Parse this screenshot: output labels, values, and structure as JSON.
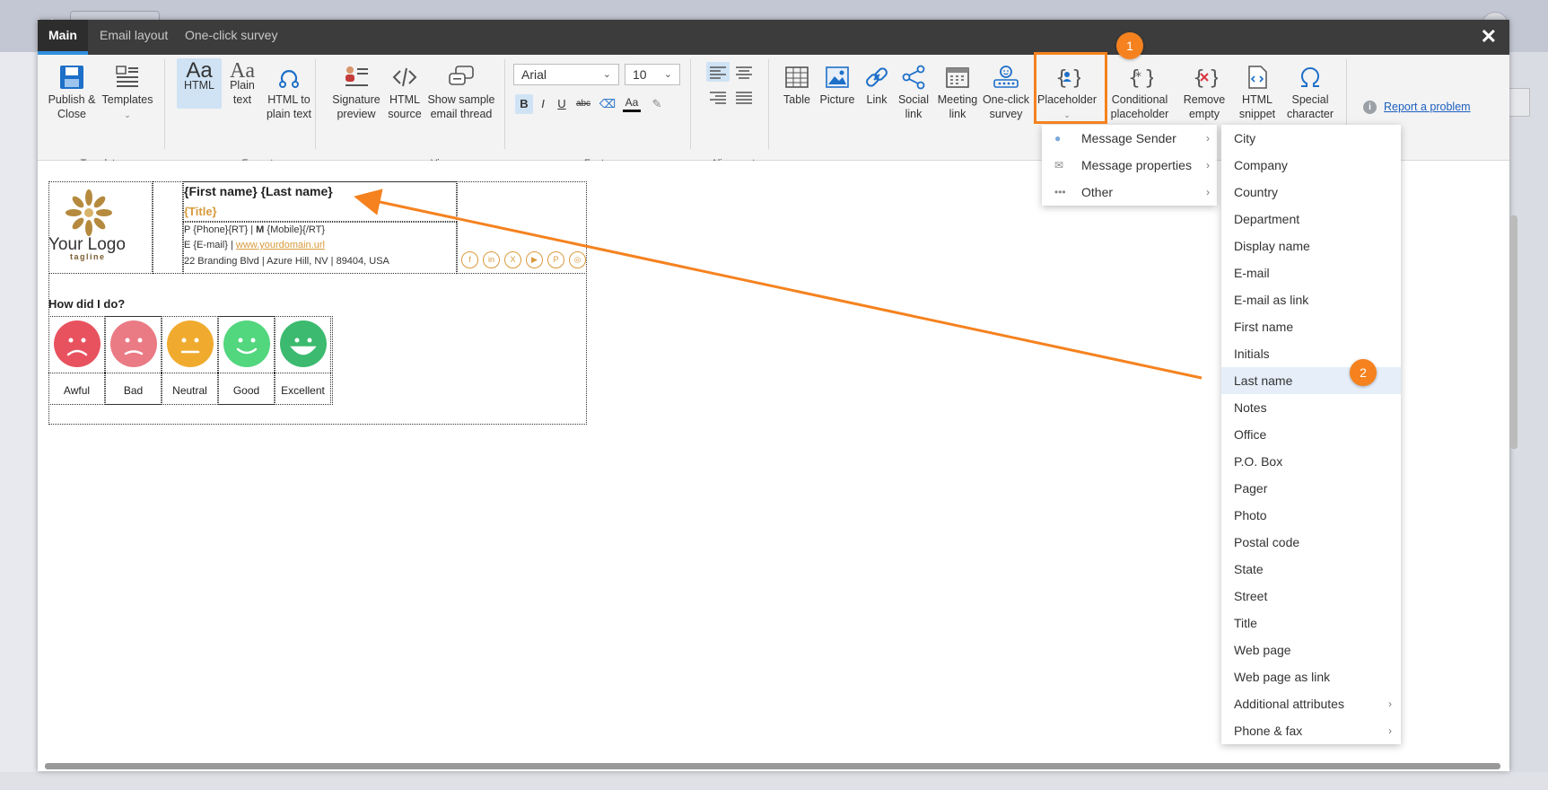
{
  "tabs": [
    {
      "label": "Main"
    },
    {
      "label": "Email layout"
    },
    {
      "label": "One-click survey"
    }
  ],
  "ribbon": {
    "template": {
      "publish": "Publish &\nClose",
      "templates": "Templates",
      "group": "Template"
    },
    "format": {
      "html": "HTML",
      "plain": "Plain\ntext",
      "html_to_plain": "HTML to\nplain text",
      "group": "Format"
    },
    "view": {
      "signature_preview": "Signature\npreview",
      "html_source": "HTML\nsource",
      "sample_thread": "Show sample\nemail thread",
      "group": "View"
    },
    "font": {
      "family": "Arial",
      "size": "10",
      "group": "Font",
      "bold": "B",
      "italic": "I",
      "underline": "U",
      "strike": "abc",
      "font_color": "Aa"
    },
    "alignment": {
      "group": "Alignment"
    },
    "insert": {
      "table": "Table",
      "picture": "Picture",
      "link": "Link",
      "social_link": "Social\nlink",
      "meeting_link": "Meeting\nlink",
      "one_click_survey": "One-click\nsurvey",
      "placeholder": "Placeholder",
      "conditional_placeholder": "Conditional\nplaceholder",
      "remove_empty": "Remove\nempty",
      "html_snippet": "HTML\nsnippet",
      "special_character": "Special\ncharacter"
    },
    "report_problem": "Report a problem"
  },
  "callouts": {
    "one": "1",
    "two": "2"
  },
  "signature": {
    "logo_text": "Your Logo",
    "tagline": "tagline",
    "name": "{First name} {Last name}",
    "title": "{Title}",
    "phone_label_p": "P",
    "phone_value": "{Phone}{RT}",
    "mobile_label_m": "M",
    "mobile_value": "{Mobile}{/RT}",
    "email_label": "E",
    "email_value": "{E-mail}",
    "website": "www.yourdomain.url",
    "address": "22 Branding Blvd | Azure Hill, NV | 89404, USA",
    "socials": [
      "f",
      "in",
      "X",
      "▶",
      "P",
      "◎"
    ]
  },
  "survey": {
    "question": "How did I do?",
    "options": [
      {
        "label": "Awful",
        "color": "#e8525f"
      },
      {
        "label": "Bad",
        "color": "#ea7a84"
      },
      {
        "label": "Neutral",
        "color": "#f0ab2e"
      },
      {
        "label": "Good",
        "color": "#52d67e"
      },
      {
        "label": "Excellent",
        "color": "#3cba6f"
      }
    ]
  },
  "placeholder_menu": [
    {
      "label": "Message Sender",
      "icon": "person-icon"
    },
    {
      "label": "Message properties",
      "icon": "envelope-icon"
    },
    {
      "label": "Other",
      "icon": "more-icon"
    }
  ],
  "sender_menu": [
    "City",
    "Company",
    "Country",
    "Department",
    "Display name",
    "E-mail",
    "E-mail as link",
    "First name",
    "Initials",
    "Last name",
    "Notes",
    "Office",
    "P.O. Box",
    "Pager",
    "Photo",
    "Postal code",
    "State",
    "Street",
    "Title",
    "Web page",
    "Web page as link",
    "Additional attributes",
    "Phone & fax"
  ],
  "sender_menu_highlighted": "Last name",
  "colors": {
    "accent": "#f5821f",
    "brand_gold": "#d89a3c",
    "tab_active_underline": "#2f8fe0"
  }
}
